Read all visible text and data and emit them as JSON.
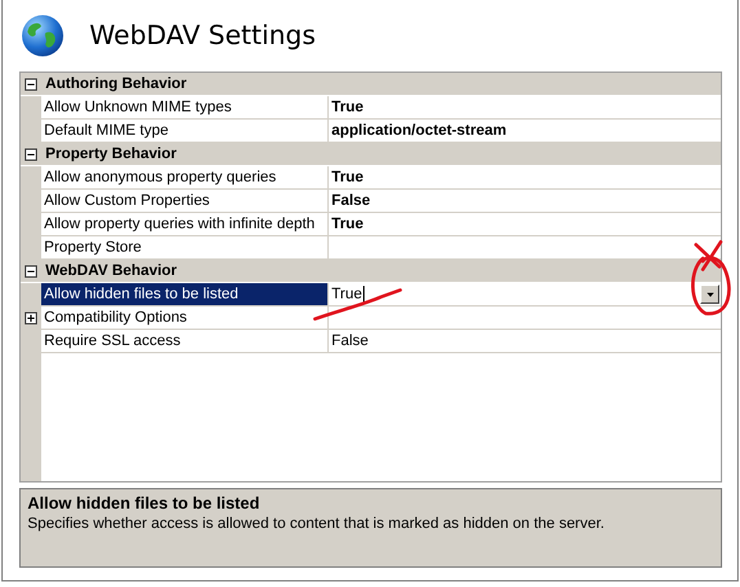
{
  "window": {
    "title": "WebDAV Settings"
  },
  "categories": [
    {
      "name": "Authoring Behavior",
      "expanded": true,
      "rows": [
        {
          "kind": "property",
          "label": "Allow Unknown MIME types",
          "value": "True",
          "non_default": true,
          "selected": false
        },
        {
          "kind": "property",
          "label": "Default MIME type",
          "value": "application/octet-stream",
          "non_default": true,
          "selected": false
        }
      ]
    },
    {
      "name": "Property Behavior",
      "expanded": true,
      "rows": [
        {
          "kind": "property",
          "label": "Allow anonymous property queries",
          "value": "True",
          "non_default": true,
          "selected": false
        },
        {
          "kind": "property",
          "label": "Allow Custom Properties",
          "value": "False",
          "non_default": true,
          "selected": false
        },
        {
          "kind": "property",
          "label": "Allow property queries with infinite depth",
          "value": "True",
          "non_default": true,
          "selected": false
        },
        {
          "kind": "property",
          "label": "Property Store",
          "selected": false
        }
      ]
    },
    {
      "name": "WebDAV Behavior",
      "expanded": true,
      "rows": [
        {
          "kind": "property",
          "label": "Allow hidden files to be listed",
          "value": "True",
          "non_default": false,
          "selected": true
        },
        {
          "kind": "group",
          "label": "Compatibility Options",
          "expanded": false,
          "selected": false
        },
        {
          "kind": "property",
          "label": "Require SSL access",
          "value": "False",
          "non_default": false,
          "selected": false
        }
      ]
    }
  ],
  "description": {
    "title": "Allow hidden files to be listed",
    "text": "Specifies whether access is allowed to content that is marked as hidden on the server."
  }
}
